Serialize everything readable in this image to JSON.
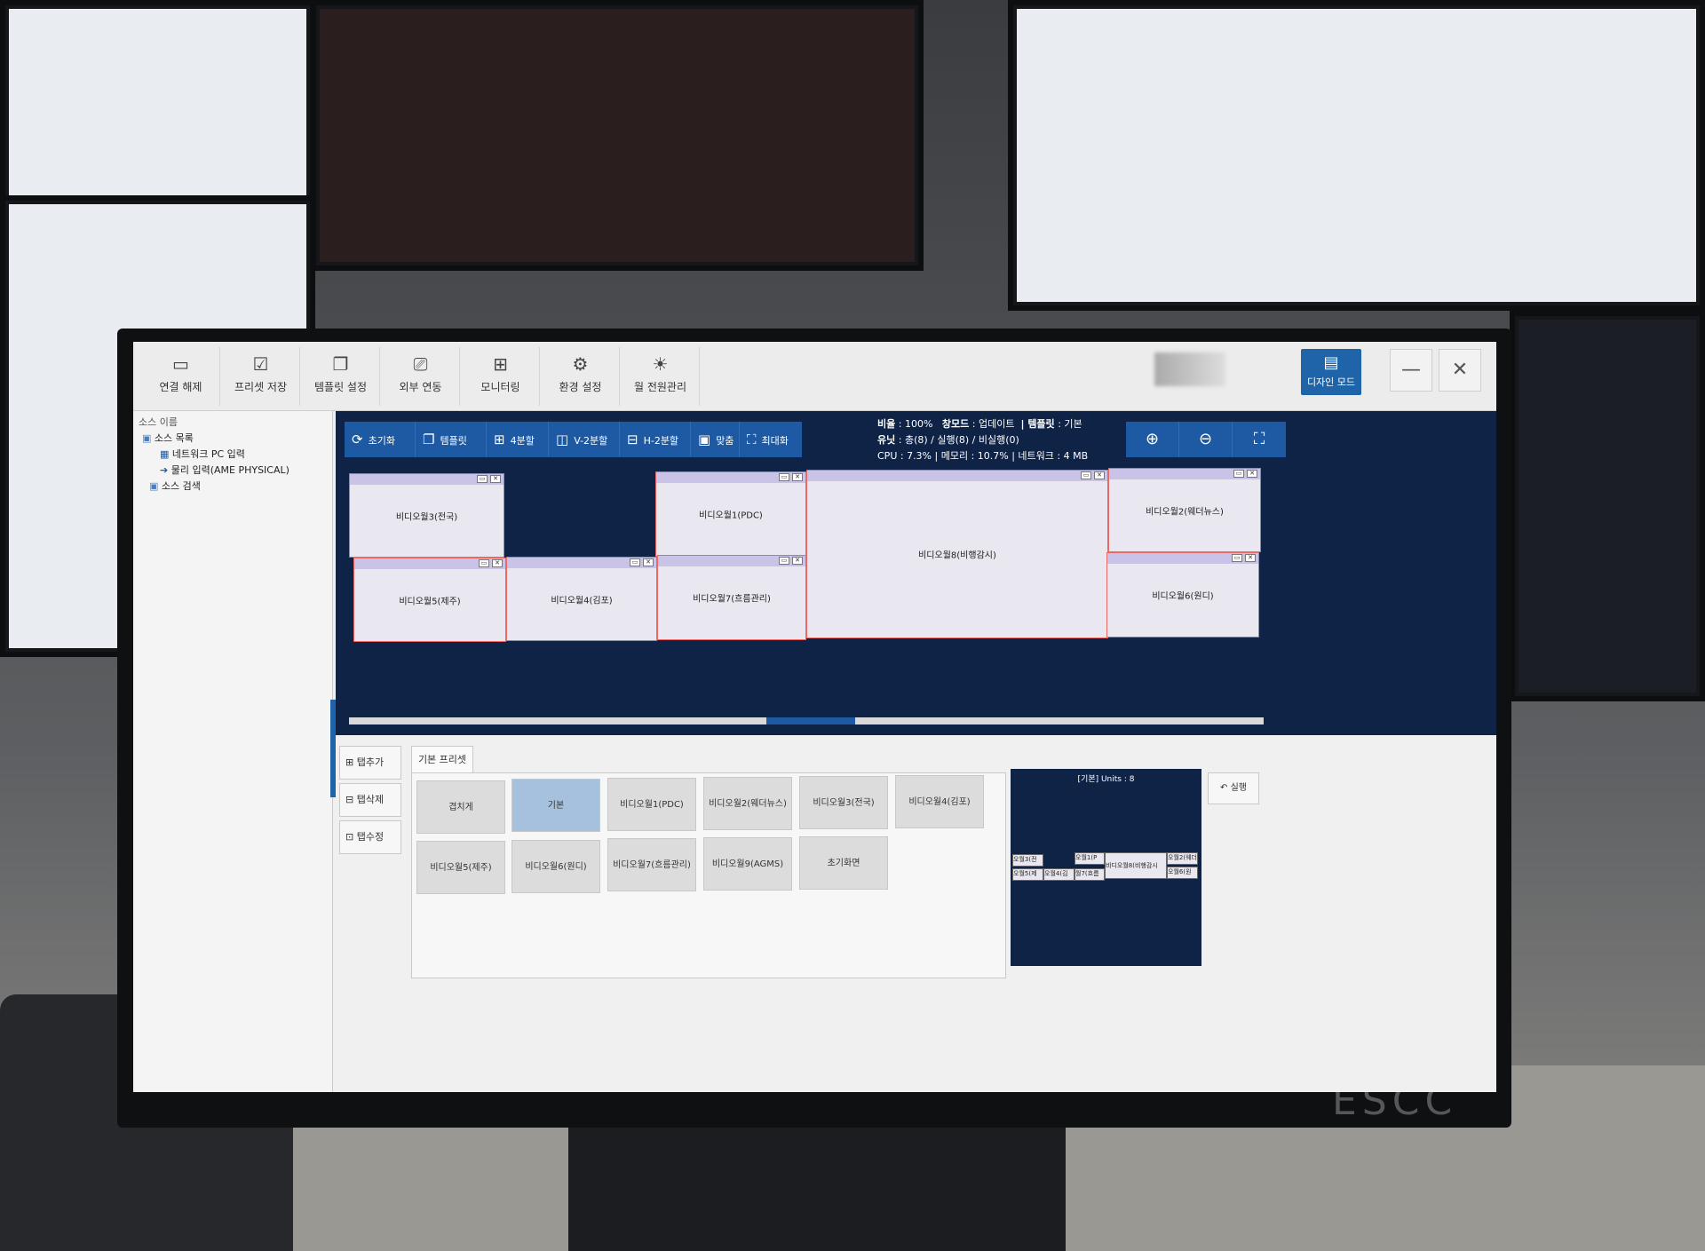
{
  "toolbar": {
    "items": [
      {
        "label": "연결 해제",
        "icon": "disconnect-icon"
      },
      {
        "label": "프리셋 저장",
        "icon": "preset-save-icon"
      },
      {
        "label": "템플릿 설정",
        "icon": "template-icon"
      },
      {
        "label": "외부 연동",
        "icon": "external-link-icon"
      },
      {
        "label": "모니터링",
        "icon": "grid-icon"
      },
      {
        "label": "환경 설정",
        "icon": "gear-icon"
      },
      {
        "label": "월 전원관리",
        "icon": "power-icon"
      }
    ],
    "design_mode_label": "디자인 모드"
  },
  "tree": {
    "header": "소스 이름",
    "root": "소스 목록",
    "children": [
      "네트워크 PC 입력",
      "물리 입력(AME PHYSICAL)"
    ],
    "search": "소스 검색"
  },
  "wall_tools": [
    "초기화",
    "템플릿",
    "4분할",
    "V-2분할",
    "H-2분할",
    "맞춤",
    "최대화"
  ],
  "stats": {
    "ratio_label": "비율",
    "ratio_value": ": 100%",
    "window_mode_label": "창모드",
    "window_mode_value": ": 업데이트",
    "template_label": "| 템플릿",
    "template_value": ": 기본",
    "units_label": "유닛",
    "units_value": ": 총(8) / 실행(8) / 비실행(0)",
    "perf": "CPU : 7.3%  |  메모리 : 10.7%  |  네트워크 : 4 MB"
  },
  "wall_windows": [
    "비디오월3(전국)",
    "비디오월1(PDC)",
    "비디오월8(비행감시)",
    "비디오월2(웨더뉴스)",
    "비디오월5(제주)",
    "비디오월4(김포)",
    "비디오월7(흐름관리)",
    "비디오월6(원디)"
  ],
  "side_buttons": [
    "탭추가",
    "탭삭제",
    "탭수정"
  ],
  "preset_tab": "기본 프리셋",
  "presets": [
    {
      "label": "겹치게",
      "selected": false
    },
    {
      "label": "기본",
      "selected": true
    },
    {
      "label": "비디오월1(PDC)",
      "selected": false
    },
    {
      "label": "비디오월2(웨더뉴스)",
      "selected": false
    },
    {
      "label": "비디오월3(전국)",
      "selected": false
    },
    {
      "label": "비디오월4(김포)",
      "selected": false
    },
    {
      "label": "비디오월5(제주)",
      "selected": false
    },
    {
      "label": "비디오월6(원디)",
      "selected": false
    },
    {
      "label": "비디오월7(흐름관리)",
      "selected": false
    },
    {
      "label": "비디오월9(AGMS)",
      "selected": false
    },
    {
      "label": "초기화면",
      "selected": false
    }
  ],
  "preview": {
    "title": "[기본] Units : 8",
    "cells": [
      "오월3(전",
      "오월1(P",
      "비디오월8(비행감시",
      "오월2(웨더",
      "오월5(제",
      "오월4(김",
      "월7(흐름",
      "오월6(원"
    ]
  },
  "run_label": "실행",
  "watermark": "ESCC"
}
